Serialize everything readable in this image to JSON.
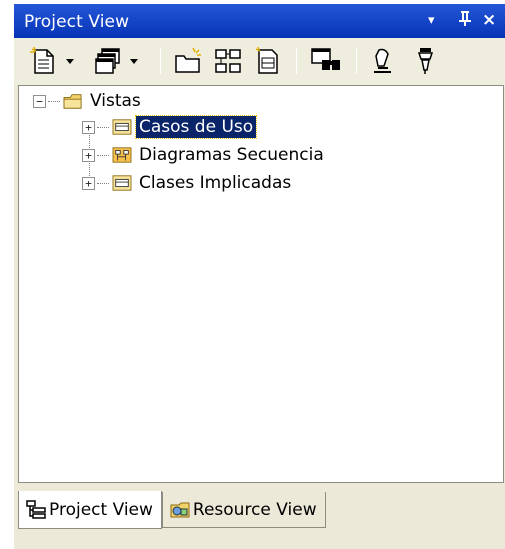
{
  "window": {
    "title": "Project View",
    "controls": {
      "dropdown": "▾",
      "pin": "⊥",
      "close": "×"
    }
  },
  "toolbar": {
    "buttons": [
      {
        "icon": "new-file-icon",
        "has_dropdown": true
      },
      {
        "icon": "windows-icon",
        "has_dropdown": true
      },
      {
        "icon": "new-folder-icon"
      },
      {
        "icon": "diagram-icon"
      },
      {
        "icon": "properties-icon"
      },
      {
        "icon": "find-icon"
      },
      {
        "icon": "pen-icon"
      },
      {
        "icon": "filter-icon"
      }
    ]
  },
  "tree": {
    "root": {
      "label": "Vistas",
      "icon": "package-folder-icon",
      "expanded": true
    },
    "children": [
      {
        "label": "Casos de Uso",
        "icon": "use-case-diagram-icon",
        "selected": true,
        "expanded": false
      },
      {
        "label": "Diagramas Secuencia",
        "icon": "sequence-diagram-icon",
        "selected": false,
        "expanded": false
      },
      {
        "label": "Clases Implicadas",
        "icon": "class-diagram-icon",
        "selected": false,
        "expanded": false
      }
    ]
  },
  "tabs": [
    {
      "label": "Project View",
      "icon": "project-tree-icon",
      "active": true
    },
    {
      "label": "Resource View",
      "icon": "resource-icon",
      "active": false
    }
  ]
}
